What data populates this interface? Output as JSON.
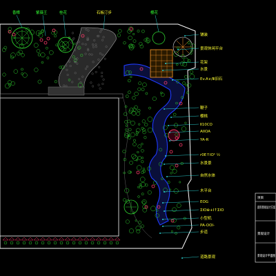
{
  "colors": {
    "background": "#000000",
    "boundary": "#ffffff",
    "building": "#ffffff",
    "plants": "#2fd12f",
    "flowers": "#ff3b6b",
    "water": "#1f3bff",
    "callout": "#ffff33",
    "leader": "#33ffff",
    "deck": "#ff9a2a",
    "paving": "#aaaaaa",
    "title_block": "#ffffff"
  },
  "top_labels": [
    {
      "id": "tl1",
      "text": "香樟"
    },
    {
      "id": "tl2",
      "text": "紫薇王"
    },
    {
      "id": "tl3",
      "text": "桂花"
    },
    {
      "id": "tl4",
      "text": "石板汀步"
    },
    {
      "id": "tl5",
      "text": "樱花"
    }
  ],
  "right_labels": [
    {
      "id": "r1",
      "text": "铺装"
    },
    {
      "id": "r2",
      "text": "景观休闲平台"
    },
    {
      "id": "r3",
      "text": "花架"
    },
    {
      "id": "r4",
      "text": "水景"
    },
    {
      "id": "r5",
      "text": "Ev.A∨/Ⅲ旧石"
    },
    {
      "id": "r6",
      "text": "鞭子"
    },
    {
      "id": "r7",
      "text": "樱桃"
    },
    {
      "id": "r8",
      "text": "Ⅱ10CO"
    },
    {
      "id": "r9",
      "text": "AIIOA"
    },
    {
      "id": "r10",
      "text": "YA-R"
    },
    {
      "id": "r11",
      "text": "r0E↑IO¹ ½"
    },
    {
      "id": "r12",
      "text": "水景景"
    },
    {
      "id": "r13",
      "text": "自然水体"
    },
    {
      "id": "r14",
      "text": "木平台"
    },
    {
      "id": "r15",
      "text": "EOG"
    },
    {
      "id": "r16",
      "text": "ΣIO⊕+I↑ΣIO"
    },
    {
      "id": "r17",
      "text": "小型机"
    },
    {
      "id": "r18",
      "text": "PA-OOI-"
    },
    {
      "id": "r19",
      "text": "步道"
    },
    {
      "id": "r20",
      "text": "道路景观"
    }
  ],
  "title_block": {
    "row1": "项目",
    "row2": "庭院景观设计方案",
    "row3": "景观设计",
    "row4": "景观设计平面图"
  }
}
